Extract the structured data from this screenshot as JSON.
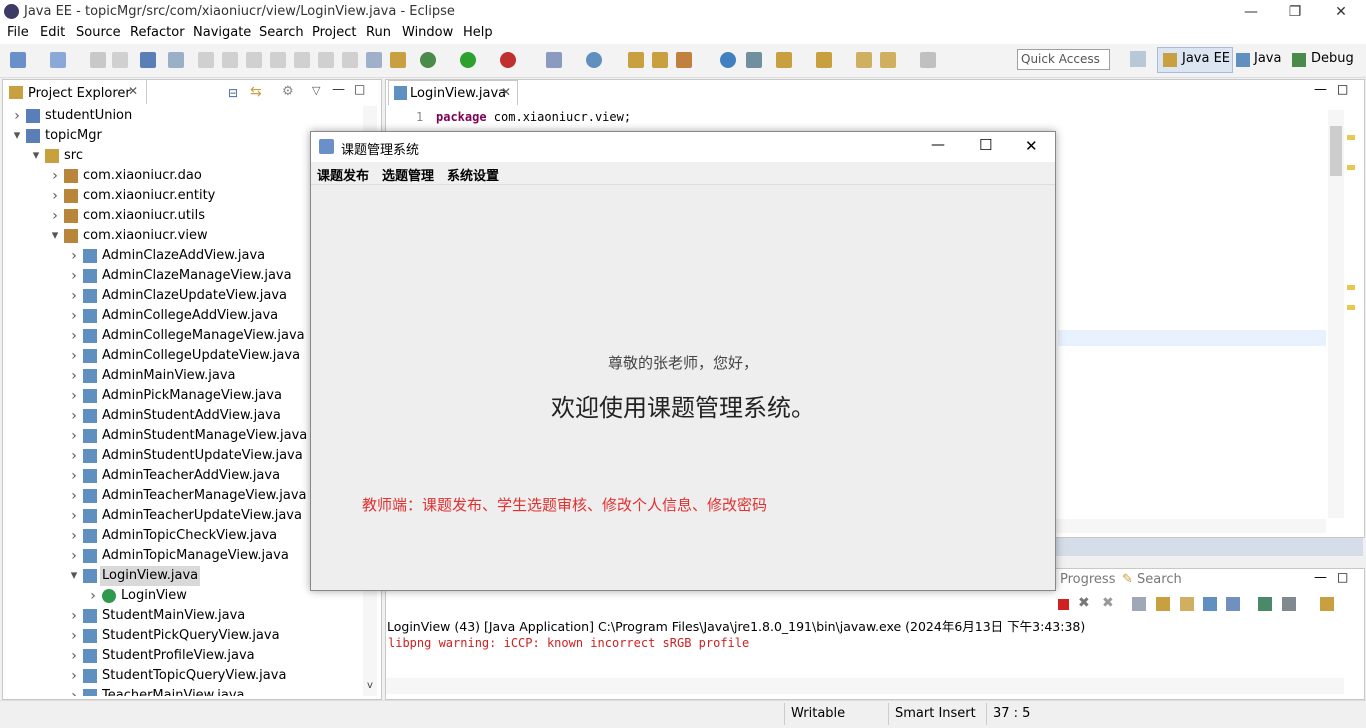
{
  "window": {
    "title": "Java EE - topicMgr/src/com/xiaoniucr/view/LoginView.java - Eclipse"
  },
  "menu": [
    "File",
    "Edit",
    "Source",
    "Refactor",
    "Navigate",
    "Search",
    "Project",
    "Run",
    "Window",
    "Help"
  ],
  "toolbar": {
    "quick_access": "Quick Access"
  },
  "perspectives": {
    "javaee": "Java EE",
    "java": "Java",
    "debug": "Debug"
  },
  "explorer": {
    "title": "Project Explorer",
    "rows": [
      {
        "label": "studentUnion",
        "indent": 0,
        "arrow": ">",
        "icon": "project"
      },
      {
        "label": "topicMgr",
        "indent": 0,
        "arrow": "v",
        "icon": "project"
      },
      {
        "label": "src",
        "indent": 1,
        "arrow": "v",
        "icon": "folder"
      },
      {
        "label": "com.xiaoniucr.dao",
        "indent": 2,
        "arrow": ">",
        "icon": "package"
      },
      {
        "label": "com.xiaoniucr.entity",
        "indent": 2,
        "arrow": ">",
        "icon": "package"
      },
      {
        "label": "com.xiaoniucr.utils",
        "indent": 2,
        "arrow": ">",
        "icon": "package"
      },
      {
        "label": "com.xiaoniucr.view",
        "indent": 2,
        "arrow": "v",
        "icon": "package"
      },
      {
        "label": "AdminClazeAddView.java",
        "indent": 3,
        "arrow": ">",
        "icon": "java"
      },
      {
        "label": "AdminClazeManageView.java",
        "indent": 3,
        "arrow": ">",
        "icon": "java"
      },
      {
        "label": "AdminClazeUpdateView.java",
        "indent": 3,
        "arrow": ">",
        "icon": "java"
      },
      {
        "label": "AdminCollegeAddView.java",
        "indent": 3,
        "arrow": ">",
        "icon": "java"
      },
      {
        "label": "AdminCollegeManageView.java",
        "indent": 3,
        "arrow": ">",
        "icon": "java"
      },
      {
        "label": "AdminCollegeUpdateView.java",
        "indent": 3,
        "arrow": ">",
        "icon": "java"
      },
      {
        "label": "AdminMainView.java",
        "indent": 3,
        "arrow": ">",
        "icon": "java"
      },
      {
        "label": "AdminPickManageView.java",
        "indent": 3,
        "arrow": ">",
        "icon": "java"
      },
      {
        "label": "AdminStudentAddView.java",
        "indent": 3,
        "arrow": ">",
        "icon": "java"
      },
      {
        "label": "AdminStudentManageView.java",
        "indent": 3,
        "arrow": ">",
        "icon": "java"
      },
      {
        "label": "AdminStudentUpdateView.java",
        "indent": 3,
        "arrow": ">",
        "icon": "java"
      },
      {
        "label": "AdminTeacherAddView.java",
        "indent": 3,
        "arrow": ">",
        "icon": "java"
      },
      {
        "label": "AdminTeacherManageView.java",
        "indent": 3,
        "arrow": ">",
        "icon": "java"
      },
      {
        "label": "AdminTeacherUpdateView.java",
        "indent": 3,
        "arrow": ">",
        "icon": "java"
      },
      {
        "label": "AdminTopicCheckView.java",
        "indent": 3,
        "arrow": ">",
        "icon": "java"
      },
      {
        "label": "AdminTopicManageView.java",
        "indent": 3,
        "arrow": ">",
        "icon": "java"
      },
      {
        "label": "LoginView.java",
        "indent": 3,
        "arrow": "v",
        "icon": "java",
        "selected": true
      },
      {
        "label": "LoginView",
        "indent": 4,
        "arrow": ">",
        "icon": "class"
      },
      {
        "label": "StudentMainView.java",
        "indent": 3,
        "arrow": ">",
        "icon": "java"
      },
      {
        "label": "StudentPickQueryView.java",
        "indent": 3,
        "arrow": ">",
        "icon": "java"
      },
      {
        "label": "StudentProfileView.java",
        "indent": 3,
        "arrow": ">",
        "icon": "java"
      },
      {
        "label": "StudentTopicQueryView.java",
        "indent": 3,
        "arrow": ">",
        "icon": "java"
      },
      {
        "label": "TeacherMainView.java",
        "indent": 3,
        "arrow": ">",
        "icon": "java"
      }
    ]
  },
  "editor": {
    "tab": "LoginView.java",
    "line_number": "1",
    "keyword": "package",
    "code": " com.xiaoniucr.view;"
  },
  "console": {
    "tabs": {
      "progress": "Progress",
      "search": "Search"
    },
    "header": "LoginView (43) [Java Application] C:\\Program Files\\Java\\jre1.8.0_191\\bin\\javaw.exe (2024年6月13日 下午3:43:38)",
    "line": "libpng warning: iCCP: known incorrect sRGB profile"
  },
  "status": {
    "writable": "Writable",
    "insert": "Smart Insert",
    "position": "37 : 5"
  },
  "dialog": {
    "title": "课题管理系统",
    "menu": [
      "课题发布",
      "选题管理",
      "系统设置"
    ],
    "greeting": "尊敬的张老师，您好，",
    "welcome": "欢迎使用课题管理系统。",
    "features": "教师端：课题发布、学生选题审核、修改个人信息、修改密码",
    "feature_color": "#e03030"
  }
}
